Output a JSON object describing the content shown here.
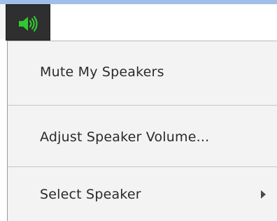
{
  "toolbar": {
    "speaker_icon": "speaker-volume-icon",
    "speaker_icon_color": "#32c832"
  },
  "menu": {
    "items": [
      {
        "label": "Mute My Speakers",
        "has_submenu": false
      },
      {
        "label": "Adjust Speaker Volume...",
        "has_submenu": false
      },
      {
        "label": "Select Speaker",
        "has_submenu": true
      }
    ]
  }
}
